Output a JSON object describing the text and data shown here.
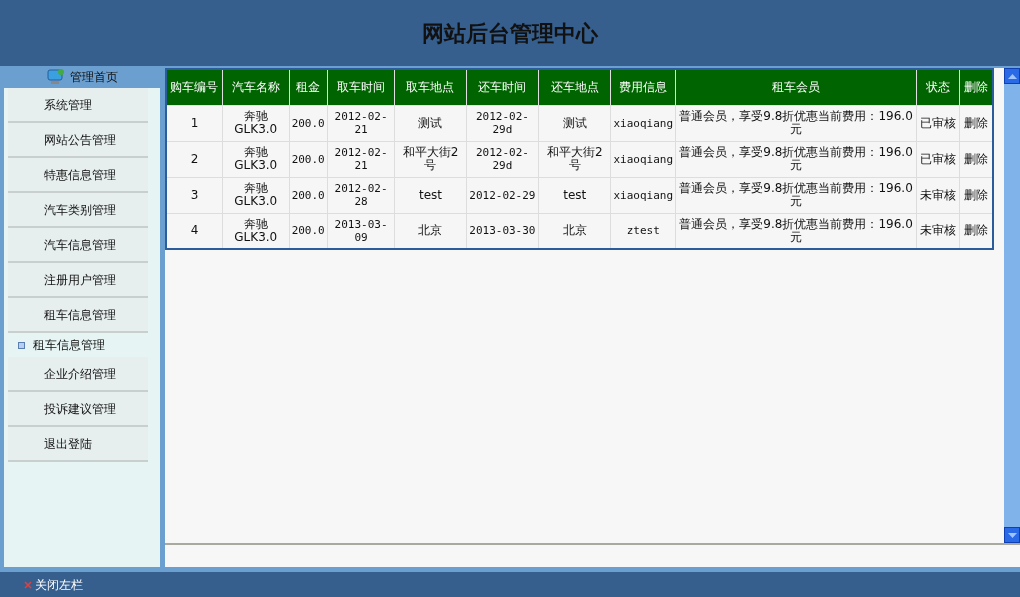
{
  "header": {
    "title": "网站后台管理中心"
  },
  "sidebar": {
    "home": "管理首页",
    "items": [
      {
        "kind": "button",
        "label": "系统管理"
      },
      {
        "kind": "button",
        "label": "网站公告管理"
      },
      {
        "kind": "button",
        "label": "特惠信息管理"
      },
      {
        "kind": "button",
        "label": "汽车类别管理"
      },
      {
        "kind": "button",
        "label": "汽车信息管理"
      },
      {
        "kind": "button",
        "label": "注册用户管理"
      },
      {
        "kind": "button",
        "label": "租车信息管理"
      },
      {
        "kind": "subitem",
        "label": "租车信息管理"
      },
      {
        "kind": "button",
        "label": "企业介绍管理"
      },
      {
        "kind": "button",
        "label": "投诉建议管理"
      },
      {
        "kind": "button",
        "label": "退出登陆"
      }
    ]
  },
  "table": {
    "columns": [
      "购车编号",
      "汽车名称",
      "租金",
      "取车时间",
      "取车地点",
      "还车时间",
      "还车地点",
      "费用信息",
      "租车会员",
      "状态",
      "删除"
    ],
    "rows": [
      [
        "1",
        "奔驰GLK3.0",
        "200.0",
        "2012-02-21",
        "测试",
        "2012-02-29d",
        "测试",
        "xiaoqiang",
        "普通会员，享受9.8折优惠当前费用：196.0元",
        "已审核",
        "删除"
      ],
      [
        "2",
        "奔驰GLK3.0",
        "200.0",
        "2012-02-21",
        "和平大街2号",
        "2012-02-29d",
        "和平大街2号",
        "xiaoqiang",
        "普通会员，享受9.8折优惠当前费用：196.0元",
        "已审核",
        "删除"
      ],
      [
        "3",
        "奔驰GLK3.0",
        "200.0",
        "2012-02-28",
        "test",
        "2012-02-29",
        "test",
        "xiaoqiang",
        "普通会员，享受9.8折优惠当前费用：196.0元",
        "未审核",
        "删除"
      ],
      [
        "4",
        "奔驰GLK3.0",
        "200.0",
        "2013-03-09",
        "北京",
        "2013-03-30",
        "北京",
        "ztest",
        "普通会员，享受9.8折优惠当前费用：196.0元",
        "未审核",
        "删除"
      ]
    ]
  },
  "footer": {
    "close_sidebar": "关闭左栏"
  }
}
